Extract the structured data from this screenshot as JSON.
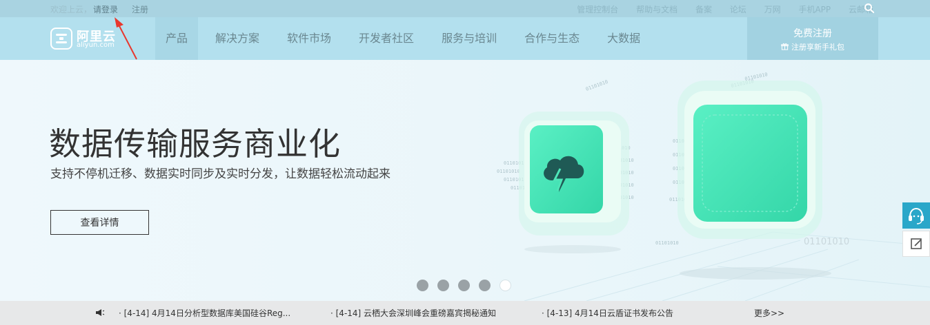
{
  "topbar": {
    "welcome": "欢迎上云，",
    "login": "请登录",
    "register": "注册",
    "links": [
      "管理控制台",
      "帮助与文档",
      "备案",
      "论坛",
      "万网",
      "手机APP",
      "云邮箱"
    ]
  },
  "nav": {
    "logo_cn": "阿里云",
    "logo_en": "aliyun.com",
    "items": [
      "产品",
      "解决方案",
      "软件市场",
      "开发者社区",
      "服务与培训",
      "合作与生态",
      "大数据"
    ],
    "register_title": "免费注册",
    "register_sub": "注册享新手礼包"
  },
  "hero": {
    "title": "数据传输服务商业化",
    "subtitle": "支持不停机迁移、数据实时同步及实时分发，让数据轻松流动起来",
    "cta": "查看详情",
    "slides": 5,
    "active_slide": 5,
    "binary_text": "01101010"
  },
  "ticker": {
    "items": [
      "· [4-14]  4月14日分析型数据库美国硅谷Reg...",
      "· [4-14]  云栖大会深圳峰会重磅嘉宾揭秘通知",
      "· [4-13]  4月14日云盾证书发布公告"
    ],
    "more": "更多>>"
  },
  "colors": {
    "topbar": "#a9d3e1",
    "nav": "#b3e0ee",
    "accent_green": "#4de2b6",
    "chat": "#2aa7c9",
    "annotation": "#e8382e"
  }
}
